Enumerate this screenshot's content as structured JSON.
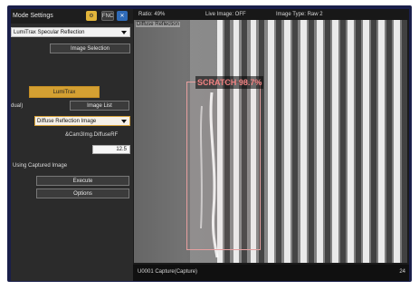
{
  "left_panel": {
    "title": "Mode Settings",
    "fnc_label": "FNC",
    "mode_select": "LumiTrax Specular Reflection",
    "image_selection_label": "Image Selection",
    "lumitrax_label": "LumiTrax",
    "dual_text": "dual)",
    "image_list_label": "Image List",
    "diffuse_select": "Diffuse Reflection Image",
    "cam_text": "&Cam3Img.DiffuseRF",
    "value_box": "12.5",
    "using_text": "Using Captured Image",
    "execute_label": "Execute",
    "options_label": "Options"
  },
  "header": {
    "ratio": "Ratio: 49%",
    "live": "Live Image: OFF",
    "type": "Image Type: Raw 2"
  },
  "image": {
    "overlay_label": "Diffuse Reflection",
    "scratch_label": "SCRATCH 98.7%"
  },
  "footer": {
    "left": "U0001 Capture(Capture)",
    "right": "24"
  },
  "colors": {
    "accent_gold": "#d4a032",
    "scratch_red": "#f08383",
    "frame_blue": "#1a1f4a"
  }
}
